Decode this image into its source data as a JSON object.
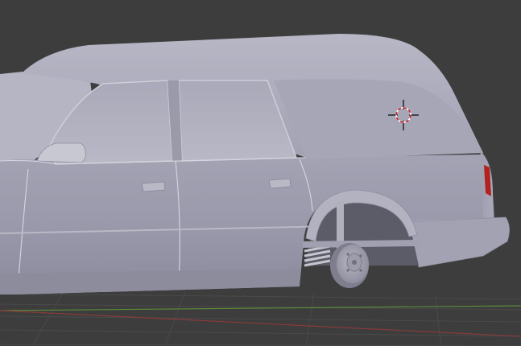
{
  "viewport": {
    "background": "#3d3d3d",
    "grid_color": "#4a4a4a",
    "x_axis_color": "#8a3a3a",
    "y_axis_color": "#5a8a3a"
  },
  "model": {
    "name": "station-wagon-hearse",
    "body_color": "#a4a4b4",
    "shadow_color": "#7d7d8f",
    "highlight_color": "#c3c3cf",
    "tail_light_color": "#b3221f"
  },
  "cursor_3d": {
    "icon": "crosshair-icon",
    "ring_color_a": "#ffffff",
    "ring_color_b": "#cc2222"
  }
}
